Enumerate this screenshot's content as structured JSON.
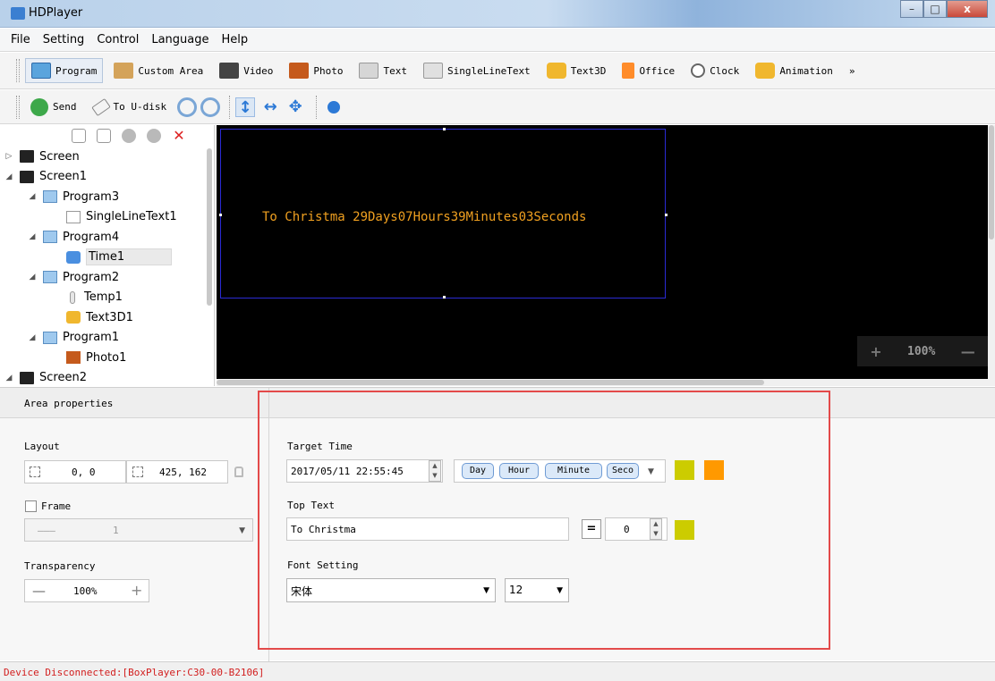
{
  "window": {
    "title": "HDPlayer",
    "min": "–",
    "max": "□",
    "close": "x"
  },
  "menu": [
    "File",
    "Setting",
    "Control",
    "Language",
    "Help"
  ],
  "toolbar1": {
    "items": [
      "Program",
      "Custom Area",
      "Video",
      "Photo",
      "Text",
      "SingleLineText",
      "Text3D",
      "Office",
      "Clock",
      "Animation"
    ],
    "overflow": "»"
  },
  "toolbar2": {
    "send": "Send",
    "to_udisk": "To U-disk"
  },
  "tree": {
    "nodes": [
      {
        "label": "Screen",
        "icon": "monitor-icon",
        "level": 0,
        "expander": "▷"
      },
      {
        "label": "Screen1",
        "icon": "monitor-icon",
        "level": 0,
        "expander": "◢"
      },
      {
        "label": "Program3",
        "icon": "program-icon",
        "level": 1,
        "expander": "◢"
      },
      {
        "label": "SingleLineText1",
        "icon": "single-line-text-icon",
        "level": 2,
        "expander": ""
      },
      {
        "label": "Program4",
        "icon": "program-icon",
        "level": 1,
        "expander": "◢"
      },
      {
        "label": "Time1",
        "icon": "time-icon",
        "level": 2,
        "expander": "",
        "selected": true
      },
      {
        "label": "Program2",
        "icon": "program-icon",
        "level": 1,
        "expander": "◢"
      },
      {
        "label": "Temp1",
        "icon": "thermometer-icon",
        "level": 2,
        "expander": ""
      },
      {
        "label": "Text3D1",
        "icon": "text3d-icon",
        "level": 2,
        "expander": ""
      },
      {
        "label": "Program1",
        "icon": "program-icon",
        "level": 1,
        "expander": "◢"
      },
      {
        "label": "Photo1",
        "icon": "photo-icon",
        "level": 2,
        "expander": ""
      },
      {
        "label": "Screen2",
        "icon": "monitor-icon",
        "level": 0,
        "expander": "◢"
      }
    ]
  },
  "canvas": {
    "text": "To Christma 29Days07Hours39Minutes03Seconds",
    "text_color": "#f0a020",
    "zoom": "100%",
    "zoom_plus": "+",
    "zoom_minus": "—"
  },
  "properties": {
    "header": "Area properties",
    "layout_label": "Layout",
    "position": "0, 0",
    "size": "425, 162",
    "frame_label": "Frame",
    "frame_value": "1",
    "transparency_label": "Transparency",
    "transparency_value": "100%",
    "minus": "—",
    "plus": "+",
    "target_time_label": "Target Time",
    "target_time_value": "2017/05/11 22:55:45",
    "units": [
      "Day",
      "Hour",
      "Minute",
      "Seco"
    ],
    "unit_color_1": "#cccc00",
    "unit_color_2": "#ff9900",
    "top_text_label": "Top Text",
    "top_text_value": "To Christma",
    "align_symbol": "=",
    "top_text_spacing": "0",
    "top_text_color": "#cccc00",
    "font_setting_label": "Font Setting",
    "font_name": "宋体",
    "font_size": "12"
  },
  "status": {
    "text": "Device Disconnected:[BoxPlayer:C30-00-B2106]"
  }
}
